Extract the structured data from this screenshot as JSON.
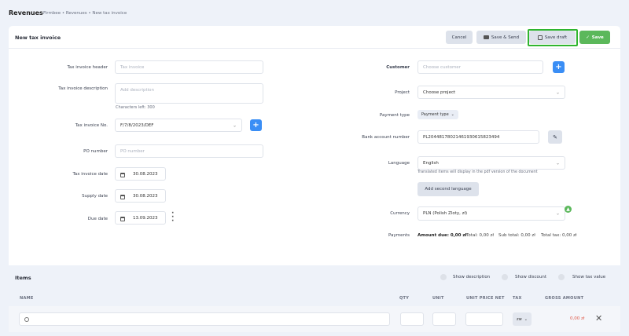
{
  "header": {
    "title": "Revenues",
    "breadcrumb": "Firmbee • Revenues • New tax invoice"
  },
  "card": {
    "title": "New tax invoice"
  },
  "actions": {
    "cancel": "Cancel",
    "save_send": "Save & Send",
    "save_draft": "Save draft",
    "save": "Save"
  },
  "form_left": {
    "header_label": "Tax invoice header",
    "header_placeholder": "Tax invoice",
    "desc_label": "Tax invoice description",
    "desc_placeholder": "Add description",
    "chars_left": "Characters left: 300",
    "no_label": "Tax invoice No.",
    "no_value": "F/7/8/2023/DEF",
    "po_label": "PO number",
    "po_placeholder": "PO number",
    "date_label": "Tax invoice date",
    "date_value": "30.08.2023",
    "supply_label": "Supply date",
    "supply_value": "30.08.2023",
    "due_label": "Due date",
    "due_value": "13.09.2023"
  },
  "form_right": {
    "customer_label": "Customer",
    "customer_placeholder": "Choose customer",
    "project_label": "Project",
    "project_value": "Choose project",
    "payment_label": "Payment type",
    "payment_value": "Payment type",
    "bank_label": "Bank account number",
    "bank_value": "PL20448178021461930615823494",
    "language_label": "Language",
    "language_value": "English",
    "language_hint": "Translated items will display in the pdf version of the document",
    "add_language": "Add second language",
    "currency_label": "Currency",
    "currency_value": "PLN (Polish Zloty, zł)",
    "payments_label": "Payments",
    "amount_due": "Amount due: 0,00 zł",
    "total": "Total: 0,00 zł",
    "sub_total": "Sub total: 0,00 zł",
    "total_tax": "Total tax: 0,00 zł"
  },
  "items": {
    "title": "Items",
    "show_description": "Show description",
    "show_discount": "Show discount",
    "show_tax": "Show tax value",
    "columns": [
      "NAME",
      "QTY",
      "UNIT",
      "UNIT PRICE NET",
      "TAX",
      "GROSS AMOUNT"
    ],
    "row": {
      "tax": "zw",
      "gross": "0,00 zł"
    }
  },
  "colors": {
    "accent": "#3a8ef5",
    "save": "#5bb85b",
    "gross": "#e05a4a"
  }
}
